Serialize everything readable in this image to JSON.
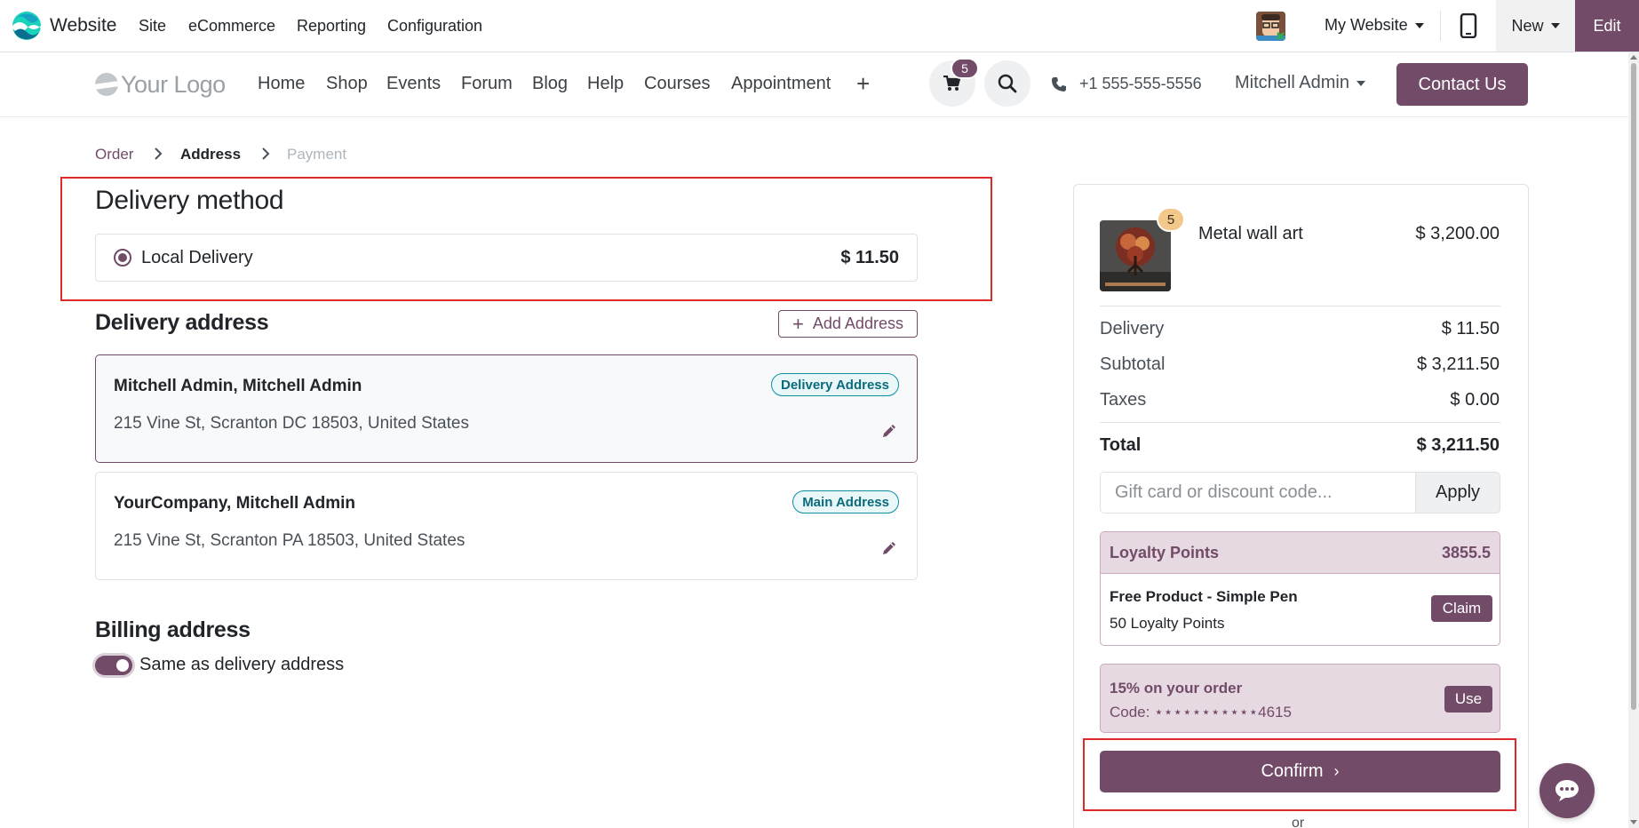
{
  "topbar": {
    "app_name": "Website",
    "menus": [
      "Site",
      "eCommerce",
      "Reporting",
      "Configuration"
    ],
    "website_selector": "My Website",
    "new_label": "New",
    "edit_label": "Edit"
  },
  "site_header": {
    "logo_text": "Your Logo",
    "nav": [
      "Home",
      "Shop",
      "Events",
      "Forum",
      "Blog",
      "Help",
      "Courses",
      "Appointment"
    ],
    "cart_count": "5",
    "phone": "+1 555-555-5556",
    "user": "Mitchell Admin",
    "contact_label": "Contact Us"
  },
  "breadcrumb": {
    "steps": [
      "Order",
      "Address",
      "Payment"
    ],
    "active": "Address"
  },
  "delivery_method": {
    "heading": "Delivery method",
    "option_name": "Local Delivery",
    "option_price": "$ 11.50"
  },
  "delivery_address": {
    "heading": "Delivery address",
    "add_label": "Add Address",
    "cards": [
      {
        "name": "Mitchell Admin, Mitchell Admin",
        "address": "215 Vine St, Scranton DC 18503, United States",
        "badge": "Delivery Address",
        "selected": true
      },
      {
        "name": "YourCompany, Mitchell Admin",
        "address": "215 Vine St, Scranton PA 18503, United States",
        "badge": "Main Address",
        "selected": false
      }
    ]
  },
  "billing": {
    "heading": "Billing address",
    "same_label": "Same as delivery address",
    "same_checked": true
  },
  "summary": {
    "product_name": "Metal wall art",
    "product_qty": "5",
    "product_price": "$ 3,200.00",
    "lines": [
      {
        "label": "Delivery",
        "value": "$ 11.50"
      },
      {
        "label": "Subtotal",
        "value": "$ 3,211.50"
      },
      {
        "label": "Taxes",
        "value": "$ 0.00"
      }
    ],
    "total_label": "Total",
    "total_value": "$ 3,211.50",
    "code_placeholder": "Gift card or discount code...",
    "apply_label": "Apply",
    "loyalty": {
      "title": "Loyalty Points",
      "points": "3855.5",
      "reward_name": "Free Product - Simple Pen",
      "reward_cost": "50 Loyalty Points",
      "claim_label": "Claim"
    },
    "coupon": {
      "title": "15% on your order",
      "code": "Code: ⋆⋆⋆⋆⋆⋆⋆⋆⋆⋆⋆4615",
      "use_label": "Use"
    },
    "confirm_label": "Confirm",
    "or_text": "or"
  },
  "colors": {
    "brand": "#714b67",
    "highlight": "#e02a2a",
    "badge": "#0d8fa4"
  }
}
